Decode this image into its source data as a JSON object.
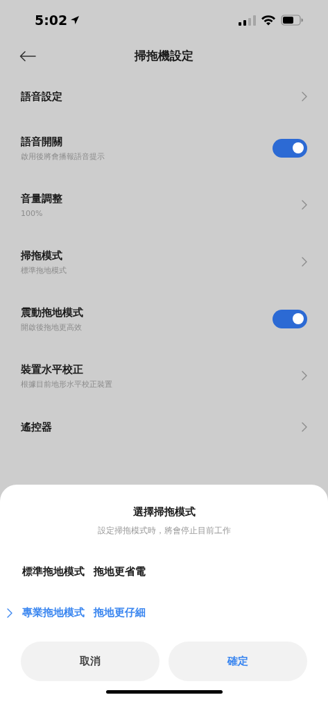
{
  "status_bar": {
    "time": "5:02"
  },
  "header": {
    "title": "掃拖機設定"
  },
  "settings": [
    {
      "kind": "link",
      "title": "語音設定"
    },
    {
      "kind": "toggle",
      "title": "語音開關",
      "subtitle": "啟用後將會播報語音提示",
      "on": true
    },
    {
      "kind": "link",
      "title": "音量調整",
      "subtitle": "100%"
    },
    {
      "kind": "link",
      "title": "掃拖模式",
      "subtitle": "標準拖地模式"
    },
    {
      "kind": "toggle",
      "title": "震動拖地模式",
      "subtitle": "開啟後拖地更高效",
      "on": true
    },
    {
      "kind": "link",
      "title": "裝置水平校正",
      "subtitle": "根據目前地形水平校正裝置"
    },
    {
      "kind": "link",
      "title": "遙控器"
    }
  ],
  "sheet": {
    "title": "選擇掃拖模式",
    "subtitle": "設定掃拖模式時，將會停止目前工作",
    "options": [
      {
        "mode": "標準拖地模式",
        "note": "拖地更省電",
        "selected": false
      },
      {
        "mode": "專業拖地模式",
        "note": "拖地更仔細",
        "selected": true
      }
    ],
    "buttons": [
      {
        "kind": "cancel",
        "label": "取消"
      },
      {
        "kind": "confirm",
        "label": "確定"
      }
    ]
  }
}
